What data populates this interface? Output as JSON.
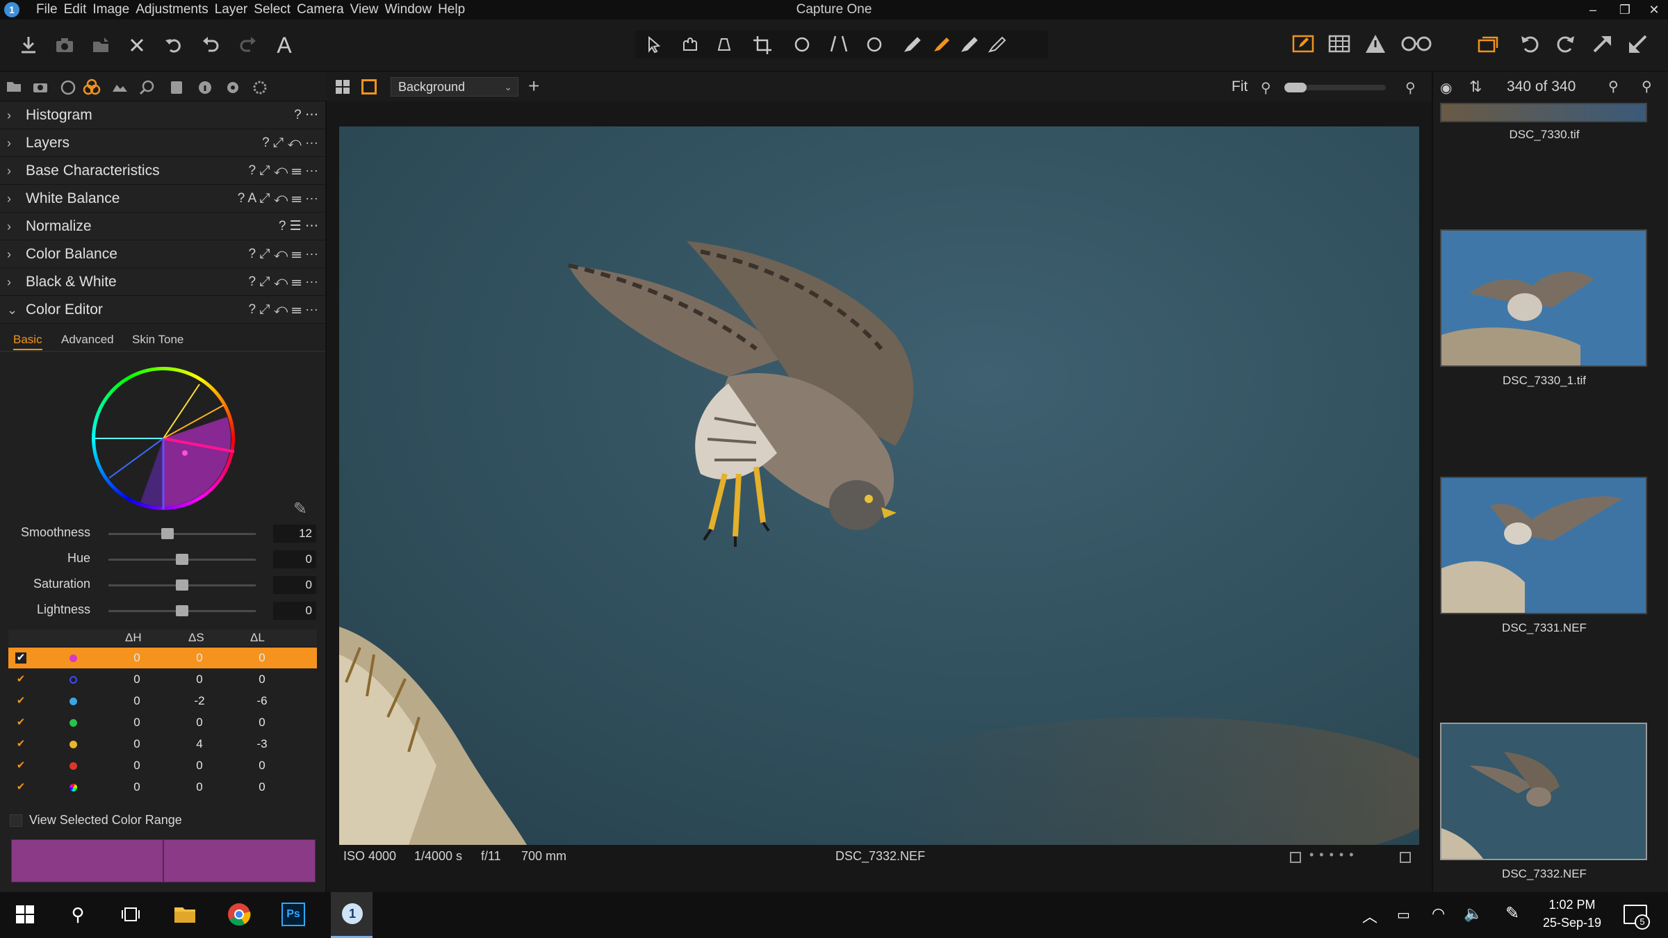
{
  "app": {
    "title": "Capture One",
    "logo": "1"
  },
  "menu": [
    "File",
    "Edit",
    "Image",
    "Adjustments",
    "Layer",
    "Select",
    "Camera",
    "View",
    "Window",
    "Help"
  ],
  "colors": {
    "accent": "#f0941e",
    "panel": "#202020",
    "selection": "#f5931e",
    "swatch": "#8a3a86"
  },
  "tool_panel": {
    "rows": [
      {
        "label": "Histogram",
        "icons": "? ⋯"
      },
      {
        "label": "Layers",
        "icons": "? ⤢ ↶ ⋯"
      },
      {
        "label": "Base Characteristics",
        "icons": "? ⤢ ↶ ☰ ⋯"
      },
      {
        "label": "White Balance",
        "icons": "? A ⤢ ↶ ☰ ⋯"
      },
      {
        "label": "Normalize",
        "icons": "? ☰ ⋯"
      },
      {
        "label": "Color Balance",
        "icons": "? ⤢ ↶ ☰ ⋯"
      },
      {
        "label": "Black & White",
        "icons": "? ⤢ ↶ ☰ ⋯"
      },
      {
        "label": "Color Editor",
        "icons": "? ⤢ ↶ ☰ ⋯"
      }
    ],
    "color_editor": {
      "tabs": [
        "Basic",
        "Advanced",
        "Skin Tone"
      ],
      "active_tab": "Basic",
      "sliders": [
        {
          "label": "Smoothness",
          "value": "12",
          "fraction": 0.4
        },
        {
          "label": "Hue",
          "value": "0",
          "fraction": 0.5
        },
        {
          "label": "Saturation",
          "value": "0",
          "fraction": 0.5
        },
        {
          "label": "Lightness",
          "value": "0",
          "fraction": 0.5
        }
      ],
      "table_headers": [
        "ΔH",
        "ΔS",
        "ΔL"
      ],
      "rows": [
        {
          "color": "#d638c8",
          "dh": "0",
          "ds": "0",
          "dl": "0",
          "selected": true,
          "ring": false
        },
        {
          "color": "#3d4bff",
          "dh": "0",
          "ds": "0",
          "dl": "0",
          "selected": false,
          "ring": true
        },
        {
          "color": "#3aa7e0",
          "dh": "0",
          "ds": "-2",
          "dl": "-6",
          "selected": false,
          "ring": false
        },
        {
          "color": "#29c34a",
          "dh": "0",
          "ds": "0",
          "dl": "0",
          "selected": false,
          "ring": false
        },
        {
          "color": "#e9b62a",
          "dh": "0",
          "ds": "4",
          "dl": "-3",
          "selected": false,
          "ring": false
        },
        {
          "color": "#d9382b",
          "dh": "0",
          "ds": "0",
          "dl": "0",
          "selected": false,
          "ring": false
        },
        {
          "color": "multi",
          "dh": "0",
          "ds": "0",
          "dl": "0",
          "selected": false,
          "ring": false
        }
      ],
      "view_selected_label": "View Selected Color Range"
    }
  },
  "viewer": {
    "layer_select": "Background",
    "zoom_label": "Fit",
    "count": "340 of 340",
    "iso": "ISO 4000",
    "shutter": "1/4000 s",
    "aperture": "f/11",
    "focal": "700 mm",
    "filename": "DSC_7332.NEF"
  },
  "browser": {
    "thumbs": [
      {
        "name": "DSC_7330.tif",
        "selected": false
      },
      {
        "name": "DSC_7330_1.tif",
        "selected": false
      },
      {
        "name": "DSC_7331.NEF",
        "selected": false
      },
      {
        "name": "DSC_7332.NEF",
        "selected": true
      }
    ]
  },
  "taskbar": {
    "time": "1:02 PM",
    "date": "25-Sep-19",
    "notifications": "5"
  }
}
